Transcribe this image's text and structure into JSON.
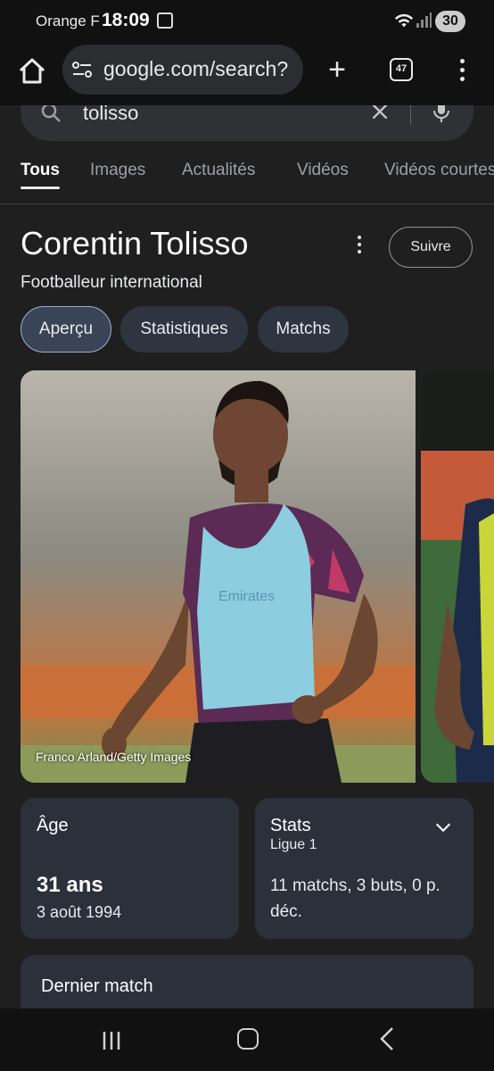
{
  "status_bar": {
    "carrier": "Orange F",
    "time": "18:09",
    "battery": "30"
  },
  "browser": {
    "url": "google.com/search?",
    "tab_count": "47"
  },
  "search": {
    "query": "tolisso"
  },
  "tabs": [
    "Tous",
    "Images",
    "Actualités",
    "Vidéos",
    "Vidéos courtes"
  ],
  "knowledge_panel": {
    "title": "Corentin Tolisso",
    "subtitle": "Footballeur international",
    "follow_label": "Suivre",
    "chips": [
      "Aperçu",
      "Statistiques",
      "Matchs"
    ],
    "image_credit": "Franco Arland/Getty Images",
    "age_card": {
      "label": "Âge",
      "value": "31 ans",
      "birthdate": "3 août 1994"
    },
    "stats_card": {
      "label": "Stats",
      "league": "Ligue 1",
      "value": "11 matchs, 3 buts, 0 p. déc."
    },
    "last_match_label": "Dernier match"
  },
  "colors": {
    "background": "#1f1f1f",
    "card": "#2c303a",
    "chip": "#2e3440"
  }
}
